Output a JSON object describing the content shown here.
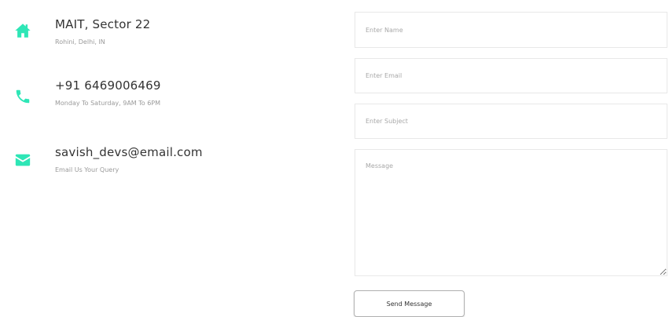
{
  "accent_color": "#2ee6b6",
  "contact": {
    "address": {
      "icon": "home-icon",
      "title": "MAIT, Sector 22",
      "subtitle": "Rohini, Delhi, IN"
    },
    "phone": {
      "icon": "phone-icon",
      "title": "+91 6469006469",
      "subtitle": "Monday To Saturday, 9AM To 6PM"
    },
    "email": {
      "icon": "envelope-icon",
      "title": "savish_devs@email.com",
      "subtitle": "Email Us Your Query"
    }
  },
  "form": {
    "name_placeholder": "Enter Name",
    "email_placeholder": "Enter Email",
    "subject_placeholder": "Enter Subject",
    "message_placeholder": "Message",
    "send_label": "Send Message"
  }
}
